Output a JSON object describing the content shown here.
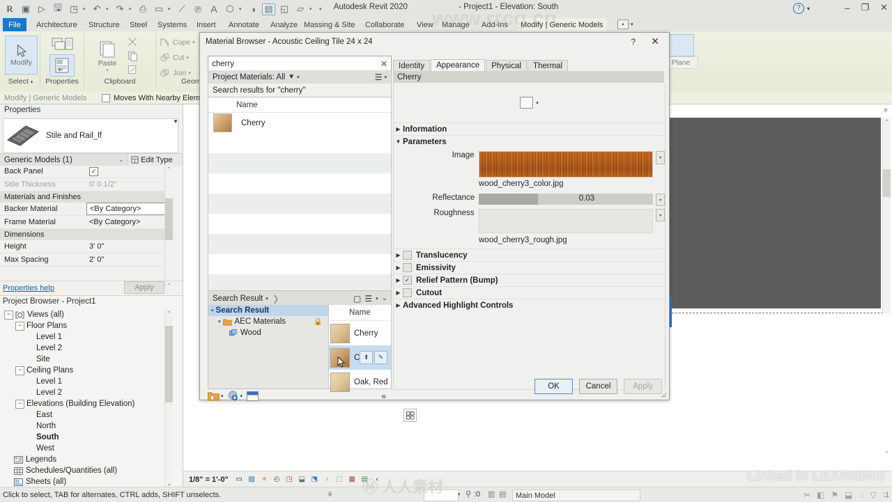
{
  "titlebar": {
    "app_title": "Autodesk Revit 2020",
    "doc_title": "- Project1 - Elevation: South",
    "logo": "R",
    "quick_access": [
      {
        "name": "open-icon",
        "glyph": "▷"
      },
      {
        "name": "save-icon",
        "glyph": "▤"
      },
      {
        "name": "save-as-icon",
        "glyph": "◳"
      },
      {
        "name": "undo-icon",
        "glyph": "↶"
      },
      {
        "name": "redo-icon",
        "glyph": "↷"
      },
      {
        "name": "print-icon",
        "glyph": "⎙"
      },
      {
        "name": "measure-icon",
        "glyph": "▭"
      },
      {
        "name": "aligned-dimension-icon",
        "glyph": "↗"
      },
      {
        "name": "tag-icon",
        "glyph": "℗"
      },
      {
        "name": "text-icon",
        "glyph": "A"
      },
      {
        "name": "default-3d-view-icon",
        "glyph": "⬡"
      },
      {
        "name": "section-icon",
        "glyph": "◑"
      },
      {
        "name": "thin-lines-icon",
        "glyph": "▤"
      },
      {
        "name": "close-hidden-icon",
        "glyph": "◱"
      },
      {
        "name": "switch-windows-icon",
        "glyph": "▱"
      }
    ],
    "help_label": "?",
    "window_buttons": [
      "–",
      "❐",
      "✕"
    ]
  },
  "ribbon": {
    "tabs": [
      {
        "label": "File",
        "active": false
      },
      {
        "label": "Architecture",
        "active": false
      },
      {
        "label": "Structure",
        "active": false
      },
      {
        "label": "Steel",
        "active": false
      },
      {
        "label": "Systems",
        "active": false
      },
      {
        "label": "Insert",
        "active": false
      },
      {
        "label": "Annotate",
        "active": false
      },
      {
        "label": "Analyze",
        "active": false
      },
      {
        "label": "Massing & Site",
        "active": false
      },
      {
        "label": "Collaborate",
        "active": false
      },
      {
        "label": "View",
        "active": false
      },
      {
        "label": "Manage",
        "active": false
      },
      {
        "label": "Add-Ins",
        "active": false
      },
      {
        "label": "Modify | Generic Models",
        "active": true
      }
    ],
    "panels": [
      {
        "name": "select",
        "title": "Select",
        "button": "Modify"
      },
      {
        "name": "properties",
        "title": "Properties"
      },
      {
        "name": "clipboard",
        "title": "Clipboard",
        "button": "Paste"
      },
      {
        "name": "geometry",
        "title": "Geometry",
        "items": [
          "Cope",
          "Cut",
          "Join"
        ]
      }
    ],
    "work_plane_label": "Plane"
  },
  "options_bar": {
    "context_label": "Modify | Generic Models",
    "checkbox_label": "Moves With Nearby Elements",
    "checked": false
  },
  "properties_palette": {
    "header": "Properties",
    "type_name": "Stile and Rail_lf",
    "category": "Generic Models (1)",
    "edit_type": "Edit Type",
    "rows": [
      {
        "kind": "row",
        "key": "Back Panel",
        "value": "",
        "checkbox": true,
        "checked": true,
        "dim": false
      },
      {
        "kind": "row",
        "key": "Stile Thickness",
        "value": "0'  0 1/2\"",
        "dim": true
      },
      {
        "kind": "group",
        "key": "Materials and Finishes"
      },
      {
        "kind": "row",
        "key": "Backer Material",
        "value": "<By Category>",
        "boxed": true
      },
      {
        "kind": "row",
        "key": "Frame Material",
        "value": "<By Category>"
      },
      {
        "kind": "group",
        "key": "Dimensions"
      },
      {
        "kind": "row",
        "key": "Height",
        "value": "3'  0\""
      },
      {
        "kind": "row",
        "key": "Max Spacing",
        "value": "2'  0\""
      }
    ],
    "help_link": "Properties help",
    "apply_button": "Apply"
  },
  "project_browser": {
    "header": "Project Browser - Project1",
    "nodes": [
      {
        "label": "Views (all)",
        "indent": 0,
        "expander": "−",
        "icon": "views-icon",
        "bold": false
      },
      {
        "label": "Floor Plans",
        "indent": 1,
        "expander": "−",
        "bold": false
      },
      {
        "label": "Level 1",
        "indent": 2,
        "expander": "",
        "bold": false
      },
      {
        "label": "Level 2",
        "indent": 2,
        "expander": "",
        "bold": false
      },
      {
        "label": "Site",
        "indent": 2,
        "expander": "",
        "bold": false
      },
      {
        "label": "Ceiling Plans",
        "indent": 1,
        "expander": "−",
        "bold": false
      },
      {
        "label": "Level 1",
        "indent": 2,
        "expander": "",
        "bold": false
      },
      {
        "label": "Level 2",
        "indent": 2,
        "expander": "",
        "bold": false
      },
      {
        "label": "Elevations (Building Elevation)",
        "indent": 1,
        "expander": "−",
        "bold": false
      },
      {
        "label": "East",
        "indent": 2,
        "expander": "",
        "bold": false
      },
      {
        "label": "North",
        "indent": 2,
        "expander": "",
        "bold": false
      },
      {
        "label": "South",
        "indent": 2,
        "expander": "",
        "bold": true
      },
      {
        "label": "West",
        "indent": 2,
        "expander": "",
        "bold": false
      },
      {
        "label": "Legends",
        "indent": 0,
        "expander": "",
        "icon": "legends-icon",
        "bold": false
      },
      {
        "label": "Schedules/Quantities (all)",
        "indent": 0,
        "expander": "",
        "icon": "schedules-icon",
        "bold": false
      },
      {
        "label": "Sheets (all)",
        "indent": 0,
        "expander": "",
        "icon": "sheets-icon",
        "bold": false
      }
    ]
  },
  "view_control_bar": {
    "scale": "1/8\" = 1'-0\"",
    "icons": [
      "detail-level-icon",
      "visual-style-icon",
      "sun-path-icon",
      "shadows-icon",
      "render-dialog-icon",
      "crop-region-icon",
      "crop-visibility-icon",
      "temporary-hide-icon",
      "reveal-hidden-icon",
      "analytical-model-icon",
      "constraints-icon",
      "expand-arrow-icon"
    ]
  },
  "status_bar": {
    "message": "Click to select, TAB for alternates, CTRL adds, SHIFT unselects.",
    "selection_count": ":0",
    "workset": "Main Model",
    "filter_count": ":1",
    "branding": "Linked in LEARNING"
  },
  "dialog": {
    "title": "Material Browser - Acoustic Ceiling Tile 24 x 24",
    "help_glyph": "?",
    "close_glyph": "✕",
    "search": {
      "value": "cherry",
      "placeholder": "Search",
      "clear_glyph": "✕"
    },
    "filter_bar": {
      "label": "Project Materials: All",
      "filter_glyph": "▼",
      "list_view_glyph": "☰"
    },
    "results_caption": "Search results for \"cherry\"",
    "project_list": {
      "column_header": "Name",
      "rows": [
        {
          "name": "Cherry",
          "swatch": "#cfab79",
          "selected": false
        }
      ]
    },
    "library_bar": {
      "label": "Search Result",
      "new_view_glyph": "▢",
      "list_glyph": "☰",
      "collapse_glyph": "⌄⌄"
    },
    "library_tree": [
      {
        "label": "Search Result",
        "indent": 0,
        "selected": true,
        "icon": "search-result-icon"
      },
      {
        "label": "AEC Materials",
        "indent": 1,
        "selected": false,
        "icon": "folder-icon",
        "locked": true
      },
      {
        "label": "Wood",
        "indent": 2,
        "selected": false,
        "icon": "category-icon"
      }
    ],
    "library_grid": {
      "column_header": "Name",
      "rows": [
        {
          "name": "Cherry",
          "swatch": "#d8bd8d",
          "selected": false,
          "hover": false
        },
        {
          "name": "Che",
          "swatch": "#c69a62",
          "selected": true,
          "hover": true,
          "buttons": [
            {
              "name": "add-to-document-button",
              "glyph": "⬆"
            },
            {
              "name": "edit-button",
              "glyph": "✎"
            }
          ]
        },
        {
          "name": "Oak, Red",
          "swatch": "#e0c79c",
          "selected": false,
          "hover": false
        }
      ]
    },
    "library_footer_icons": [
      "new-library-icon",
      "open-library-icon",
      "show-panel-icon"
    ],
    "corner_button": "material-editor-icon",
    "asset_tabs": [
      {
        "label": "Identity",
        "active": false
      },
      {
        "label": "Appearance",
        "active": true
      },
      {
        "label": "Physical",
        "active": false
      },
      {
        "label": "Thermal",
        "active": false
      }
    ],
    "asset_name": "Cherry",
    "sections": [
      {
        "label": "Information",
        "expanded": false,
        "checkbox": false
      },
      {
        "label": "Parameters",
        "expanded": true,
        "checkbox": false
      },
      {
        "label": "Translucency",
        "expanded": false,
        "checkbox": true,
        "checked": false
      },
      {
        "label": "Emissivity",
        "expanded": false,
        "checkbox": true,
        "checked": false
      },
      {
        "label": "Relief Pattern (Bump)",
        "expanded": false,
        "checkbox": true,
        "checked": true
      },
      {
        "label": "Cutout",
        "expanded": false,
        "checkbox": true,
        "checked": false
      },
      {
        "label": "Advanced Highlight Controls",
        "expanded": false,
        "checkbox": false
      }
    ],
    "parameters": {
      "image_label": "Image",
      "image_file": "wood_cherry3_color.jpg",
      "reflectance_label": "Reflectance",
      "reflectance_value": "0.03",
      "reflectance_fill_pct": 34,
      "roughness_label": "Roughness",
      "roughness_file": "wood_cherry3_rough.jpg"
    },
    "buttons": {
      "ok": "OK",
      "cancel": "Cancel",
      "apply": "Apply"
    }
  },
  "colors": {
    "accent_blue": "#1b78c8",
    "ribbon_green": "#eef0e2",
    "selection_blue": "#c6dcf0",
    "view_background": "#5c5c5c"
  }
}
